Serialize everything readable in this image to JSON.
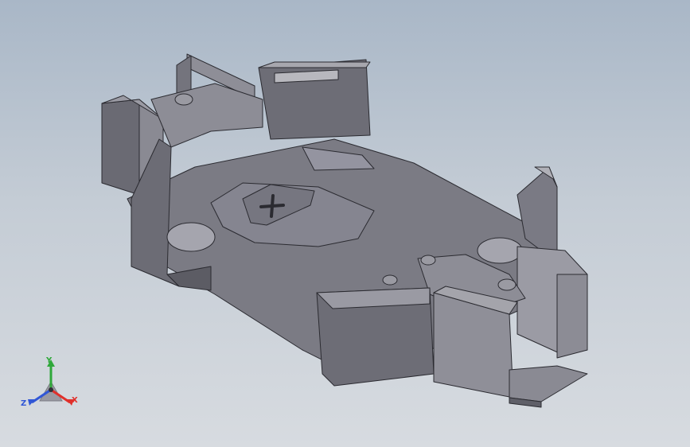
{
  "viewport": {
    "background_top": "#a9b7c7",
    "background_bottom": "#d7dbe0"
  },
  "model": {
    "shade_color": "#7a7a84",
    "edge_color": "#2b2b31"
  },
  "triad": {
    "x_label": "X",
    "y_label": "Y",
    "z_label": "Z",
    "x_color": "#e0302b",
    "y_color": "#2fa83a",
    "z_color": "#3157d6"
  }
}
